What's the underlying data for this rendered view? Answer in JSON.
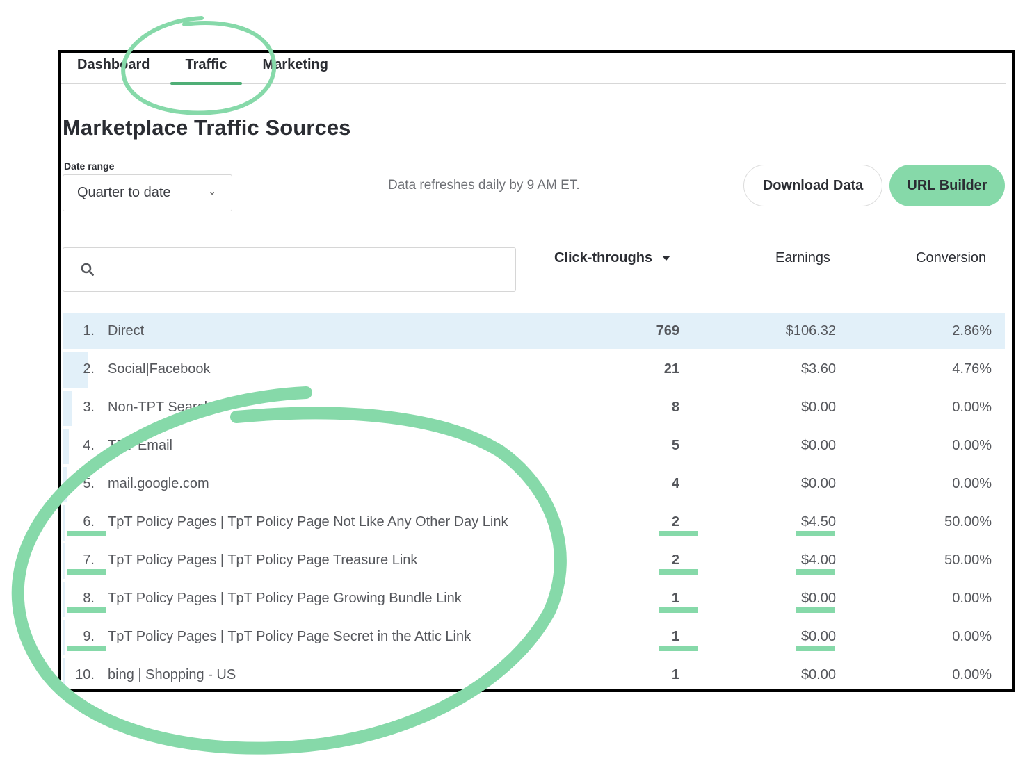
{
  "tabs": [
    {
      "label": "Dashboard",
      "active": false
    },
    {
      "label": "Traffic",
      "active": true
    },
    {
      "label": "Marketing",
      "active": false
    }
  ],
  "page_title": "Marketplace Traffic Sources",
  "date_range": {
    "label": "Date range",
    "value": "Quarter to date",
    "icon": "chevron-down-icon"
  },
  "refresh_note": "Data refreshes daily by 9 AM ET.",
  "buttons": {
    "download": "Download Data",
    "url_builder": "URL Builder"
  },
  "search": {
    "placeholder": "",
    "value": "",
    "icon": "search-icon"
  },
  "columns": {
    "clicks": "Click-throughs",
    "earnings": "Earnings",
    "conversion": "Conversion",
    "sort_icon": "caret-down-icon"
  },
  "rows": [
    {
      "rank": "1.",
      "name": "Direct",
      "clicks": "769",
      "earnings": "$106.32",
      "conversion": "2.86%",
      "share": 1.0
    },
    {
      "rank": "2.",
      "name": "Social|Facebook",
      "clicks": "21",
      "earnings": "$3.60",
      "conversion": "4.76%",
      "share": 0.027
    },
    {
      "rank": "3.",
      "name": "Non-TPT Search",
      "clicks": "8",
      "earnings": "$0.00",
      "conversion": "0.00%",
      "share": 0.0104
    },
    {
      "rank": "4.",
      "name": "TPT Email",
      "clicks": "5",
      "earnings": "$0.00",
      "conversion": "0.00%",
      "share": 0.0065
    },
    {
      "rank": "5.",
      "name": "mail.google.com",
      "clicks": "4",
      "earnings": "$0.00",
      "conversion": "0.00%",
      "share": 0.0052
    },
    {
      "rank": "6.",
      "name": "TpT Policy Pages | TpT Policy Page Not Like Any Other Day Link",
      "clicks": "2",
      "earnings": "$4.50",
      "conversion": "50.00%",
      "share": 0.0026,
      "highlighted": true
    },
    {
      "rank": "7.",
      "name": "TpT Policy Pages | TpT Policy Page Treasure Link",
      "clicks": "2",
      "earnings": "$4.00",
      "conversion": "50.00%",
      "share": 0.0026,
      "highlighted": true
    },
    {
      "rank": "8.",
      "name": "TpT Policy Pages | TpT Policy Page Growing Bundle Link",
      "clicks": "1",
      "earnings": "$0.00",
      "conversion": "0.00%",
      "share": 0.0013,
      "highlighted": true
    },
    {
      "rank": "9.",
      "name": "TpT Policy Pages | TpT Policy Page Secret in the Attic Link",
      "clicks": "1",
      "earnings": "$0.00",
      "conversion": "0.00%",
      "share": 0.0013,
      "highlighted": true
    },
    {
      "rank": "10.",
      "name": "bing | Shopping - US",
      "clicks": "1",
      "earnings": "$0.00",
      "conversion": "0.00%",
      "share": 0.0013
    }
  ],
  "colors": {
    "accent": "#86d9a9",
    "tab_underline": "#4fae76",
    "row_bar": "#e2f0f9"
  }
}
